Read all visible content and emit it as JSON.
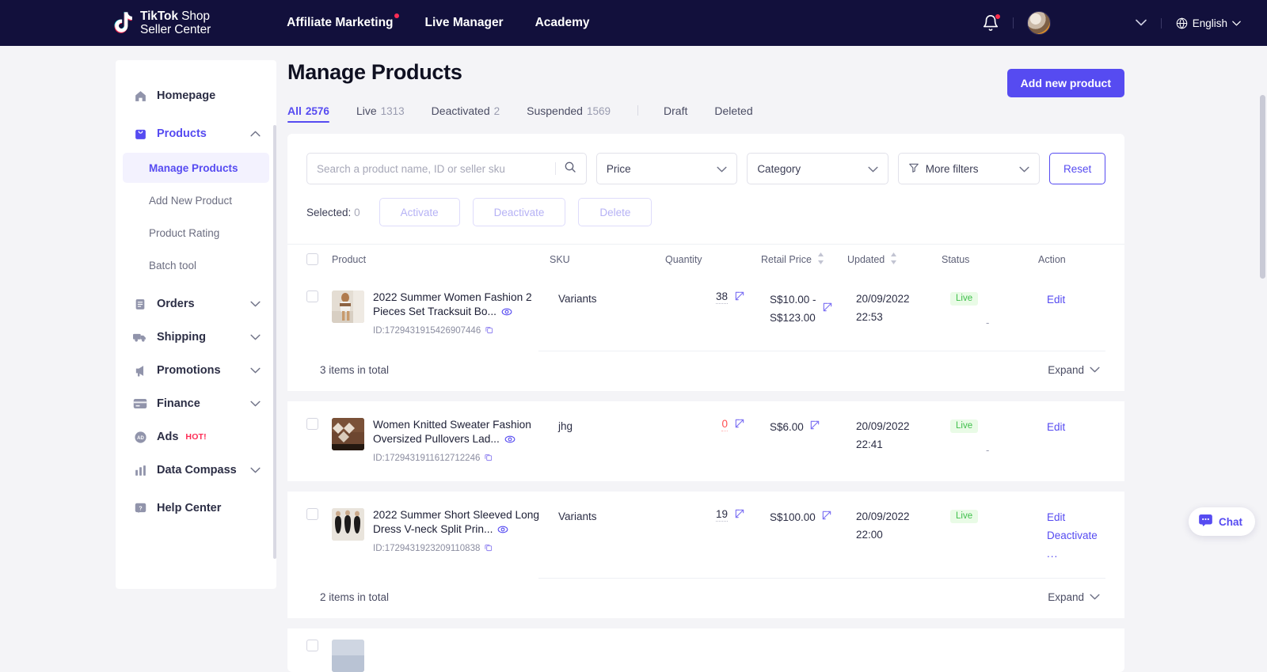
{
  "topnav": {
    "brand_line1_bold": "TikTok",
    "brand_line1_rest": " Shop",
    "brand_line2": "Seller Center",
    "links": [
      {
        "label": "Affiliate Marketing",
        "has_dot": true
      },
      {
        "label": "Live Manager",
        "has_dot": false
      },
      {
        "label": "Academy",
        "has_dot": false
      }
    ],
    "notification_icon": "bell-icon",
    "avatar_icon": "user-avatar",
    "caret_icon": "chevron-down-icon",
    "language": "English",
    "globe_icon": "globe-icon",
    "accent": "#564bf1",
    "bg": "#12103c"
  },
  "sidebar": {
    "items": [
      {
        "label": "Homepage",
        "icon": "home-icon",
        "expandable": false
      },
      {
        "label": "Products",
        "icon": "bag-icon",
        "expandable": true,
        "expanded": true,
        "active": true
      },
      {
        "label": "Orders",
        "icon": "orders-icon",
        "expandable": true
      },
      {
        "label": "Shipping",
        "icon": "truck-icon",
        "expandable": true
      },
      {
        "label": "Promotions",
        "icon": "megaphone-icon",
        "expandable": true
      },
      {
        "label": "Finance",
        "icon": "card-icon",
        "expandable": true
      },
      {
        "label": "Ads",
        "icon": "ads-icon",
        "expandable": false,
        "badge": "HOT!"
      },
      {
        "label": "Data Compass",
        "icon": "chart-icon",
        "expandable": true
      },
      {
        "label": "Help Center",
        "icon": "help-icon",
        "expandable": false
      }
    ],
    "products_sub": [
      {
        "label": "Manage Products",
        "active": true
      },
      {
        "label": "Add New Product",
        "active": false
      },
      {
        "label": "Product Rating",
        "active": false
      },
      {
        "label": "Batch tool",
        "active": false
      }
    ]
  },
  "header": {
    "title": "Manage Products",
    "add_button": "Add new product"
  },
  "tabs": [
    {
      "label": "All",
      "count": "2576",
      "active": true
    },
    {
      "label": "Live",
      "count": "1313",
      "active": false
    },
    {
      "label": "Deactivated",
      "count": "2",
      "active": false
    },
    {
      "label": "Suspended",
      "count": "1569",
      "active": false
    },
    {
      "label": "Draft",
      "count": "",
      "active": false
    },
    {
      "label": "Deleted",
      "count": "",
      "active": false
    }
  ],
  "filters": {
    "search_placeholder": "Search a product name, ID or seller sku",
    "search_value": "",
    "search_icon": "search-icon",
    "price_label": "Price",
    "category_label": "Category",
    "more_filters_label": "More filters",
    "funnel_icon": "funnel-icon",
    "reset_label": "Reset"
  },
  "bulk": {
    "selected_label": "Selected:",
    "selected_count": "0",
    "activate": "Activate",
    "deactivate": "Deactivate",
    "delete": "Delete"
  },
  "table": {
    "columns": {
      "product": "Product",
      "sku": "SKU",
      "quantity": "Quantity",
      "retail_price": "Retail Price",
      "updated": "Updated",
      "status": "Status",
      "action": "Action"
    },
    "rows": [
      {
        "name": "2022 Summer Women Fashion 2 Pieces Set Tracksuit Bo...",
        "id": "ID:1729431915426907446",
        "sku": "Variants",
        "quantity": "38",
        "quantity_zero": false,
        "price": "S$10.00 - S$123.00",
        "price_line1": "S$10.00 -",
        "price_line2": "S$123.00",
        "updated_date": "20/09/2022",
        "updated_time": "22:53",
        "status": "Live",
        "status_extra": "-",
        "actions": [
          "Edit"
        ],
        "total_text": "3 items in total",
        "expand_label": "Expand",
        "thumb_colors": [
          "#c8a07a",
          "#efe9e0",
          "#8a6a4e"
        ]
      },
      {
        "name": "Women Knitted Sweater Fashion Oversized Pullovers Lad...",
        "id": "ID:1729431911612712246",
        "sku": "jhg",
        "quantity": "0",
        "quantity_zero": true,
        "price": "S$6.00",
        "price_line1": "S$6.00",
        "price_line2": "",
        "updated_date": "20/09/2022",
        "updated_time": "22:41",
        "status": "Live",
        "status_extra": "-",
        "actions": [
          "Edit"
        ],
        "total_text": "",
        "expand_label": "",
        "thumb_colors": [
          "#6d4630",
          "#e6ddd2",
          "#3a2a20"
        ]
      },
      {
        "name": "2022 Summer Short Sleeved Long Dress V-neck Split Prin...",
        "id": "ID:1729431923209110838",
        "sku": "Variants",
        "quantity": "19",
        "quantity_zero": false,
        "price": "S$100.00",
        "price_line1": "S$100.00",
        "price_line2": "",
        "updated_date": "20/09/2022",
        "updated_time": "22:00",
        "status": "Live",
        "status_extra": "",
        "actions": [
          "Edit",
          "Deactivate",
          "..."
        ],
        "total_text": "2 items in total",
        "expand_label": "Expand",
        "thumb_colors": [
          "#e8e3db",
          "#1c1a18",
          "#cfc6bb"
        ]
      }
    ]
  },
  "chat": {
    "label": "Chat",
    "icon": "chat-icon"
  }
}
